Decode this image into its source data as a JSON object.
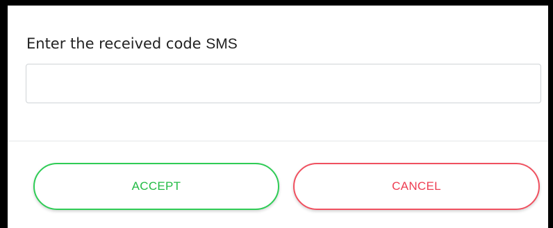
{
  "dialog": {
    "prompt_text": "Enter the received code",
    "prompt_suffix": "SMS",
    "code_input": {
      "value": "",
      "placeholder": ""
    },
    "buttons": {
      "accept_label": "ACCEPT",
      "cancel_label": "CANCEL"
    }
  },
  "colors": {
    "accept": "#22bb44",
    "cancel": "#ee3d52",
    "frame": "#000000"
  }
}
